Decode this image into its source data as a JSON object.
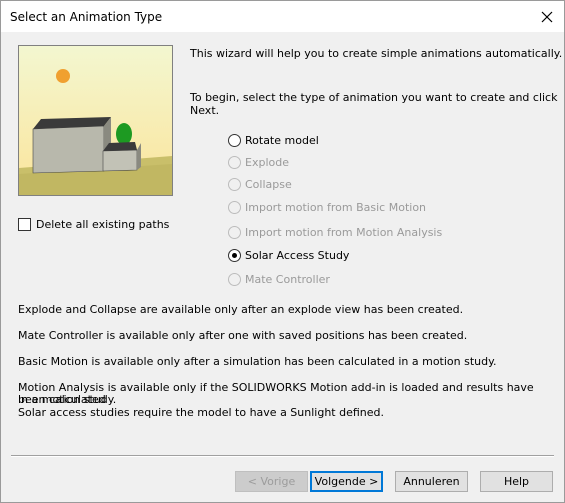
{
  "window": {
    "title": "Select an Animation Type"
  },
  "intro": {
    "line1": "This wizard will help you to create simple animations automatically.",
    "line2": "To begin, select the type of animation you want to create and click Next."
  },
  "options": [
    {
      "label": "Rotate model",
      "enabled": true,
      "selected": false
    },
    {
      "label": "Explode",
      "enabled": false,
      "selected": false
    },
    {
      "label": "Collapse",
      "enabled": false,
      "selected": false
    },
    {
      "label": "Import motion from Basic Motion",
      "enabled": false,
      "selected": false
    },
    {
      "label": "Import motion from Motion Analysis",
      "enabled": false,
      "selected": false
    },
    {
      "label": "Solar Access Study",
      "enabled": true,
      "selected": true
    },
    {
      "label": "Mate Controller",
      "enabled": false,
      "selected": false
    }
  ],
  "checkbox": {
    "label": "Delete all existing paths",
    "checked": false
  },
  "notes": {
    "explode": "Explode and Collapse are available only after an explode view has been created.",
    "mate": "Mate Controller is available only after one with saved positions has been created.",
    "basic": "Basic Motion is available only after a simulation has been calculated in a motion study.",
    "analysis_line1": "Motion Analysis is available only if the SOLIDWORKS Motion add-in is loaded and results have been calculated",
    "analysis_line2": "in a motion study.",
    "solar": "Solar access studies require the model to have a Sunlight defined."
  },
  "buttons": {
    "back": "< Vorige",
    "next": "Volgende >",
    "cancel": "Annuleren",
    "help": "Help"
  },
  "colors": {
    "sky_top": "#f3f7d0",
    "sky_bottom": "#fbe49b",
    "sun": "#f0a030",
    "ground": "#c9bf6a",
    "tree": "#1d9a22",
    "accent": "#0078d7"
  }
}
